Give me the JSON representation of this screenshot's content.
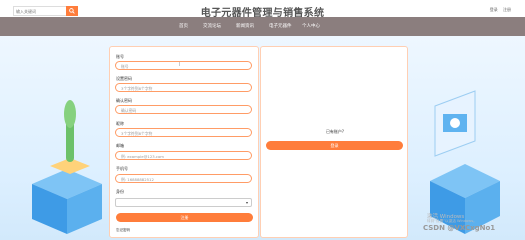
{
  "header": {
    "search_placeholder": "输入关键词",
    "title": "电子元器件管理与销售系统",
    "login": "登录",
    "register": "注册"
  },
  "nav": [
    "首页",
    "交流论坛",
    "新闻资讯",
    "电子元器件",
    "个人中心"
  ],
  "register_form": {
    "fields": [
      {
        "label": "账号",
        "placeholder": "账号"
      },
      {
        "label": "设置密码",
        "placeholder": "3个字符到8个字符"
      },
      {
        "label": "确认密码",
        "placeholder": "确认密码"
      },
      {
        "label": "昵称",
        "placeholder": "3个字符到8个字符"
      },
      {
        "label": "邮箱",
        "placeholder": "例: example@123.com"
      },
      {
        "label": "手机号",
        "placeholder": "例: 16888882512"
      }
    ],
    "role_label": "身份",
    "submit": "注册",
    "footer_note": "忘记密码"
  },
  "login_panel": {
    "prompt": "已有账户?",
    "button": "登录"
  },
  "watermark": {
    "line1": "激活 Windows",
    "line2": "转到“设置”以激活 Windows。",
    "csdn": "CSDN @VXCxgNo1"
  },
  "colors": {
    "accent": "#ff7d3b",
    "nav_bg": "#8b7e7e"
  }
}
